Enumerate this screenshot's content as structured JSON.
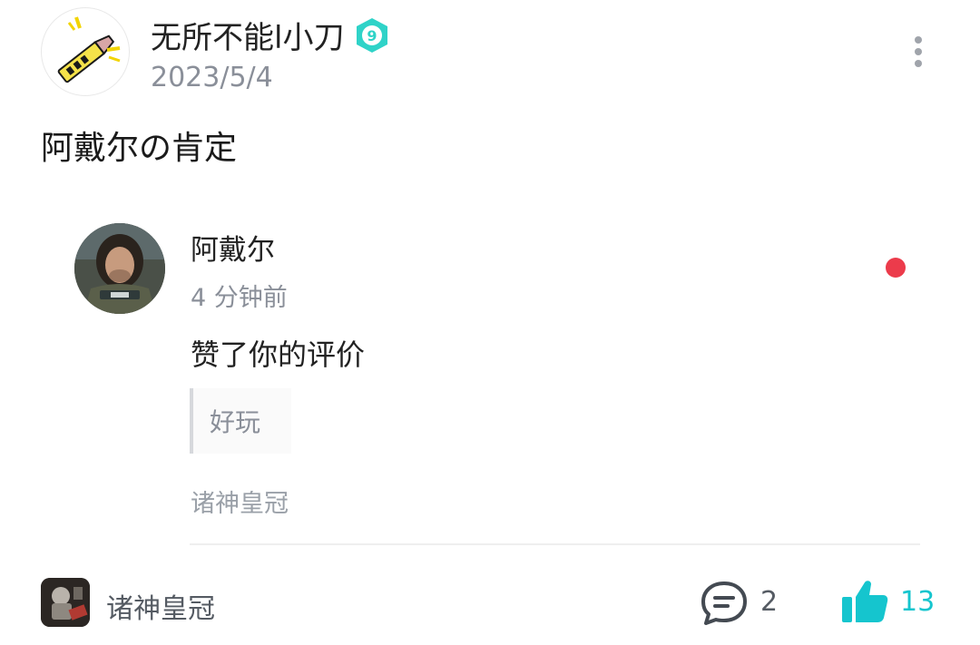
{
  "post": {
    "author": "无所不能l小刀",
    "level": "9",
    "date": "2023/5/4",
    "title": "阿戴尔の肯定"
  },
  "notification": {
    "user": "阿戴尔",
    "time": "4 分钟前",
    "action": "赞了你的评价",
    "quote": "好玩",
    "game": "诸神皇冠",
    "unread": true
  },
  "footer": {
    "game_name": "诸神皇冠",
    "comment_count": "2",
    "like_count": "13"
  },
  "colors": {
    "accent": "#15c5ce",
    "unread_dot": "#ec3b4b",
    "secondary_text": "#8a8f99"
  },
  "icons": {
    "author_avatar": "utility-knife-icon",
    "level_badge": "hexagon-level-icon",
    "more": "more-vertical-icon",
    "comment": "comment-bubble-icon",
    "like": "thumbs-up-icon"
  }
}
